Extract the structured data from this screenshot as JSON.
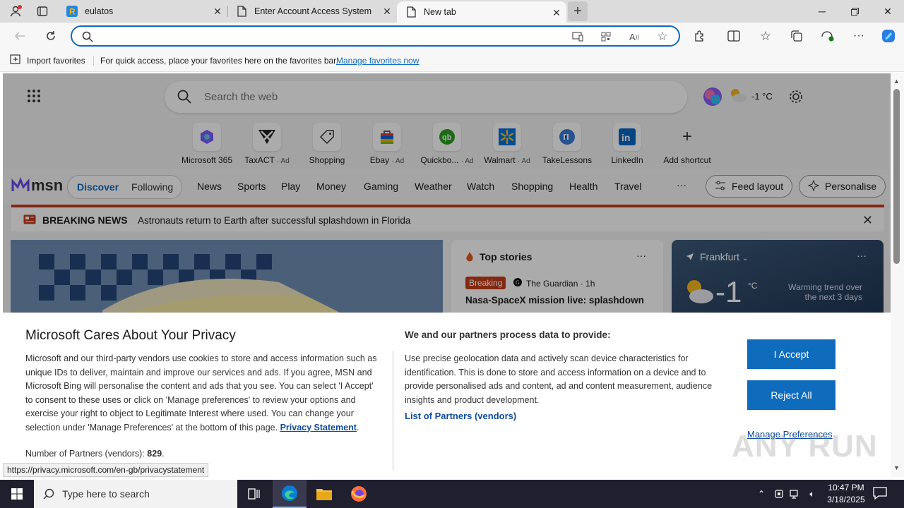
{
  "tabs": [
    {
      "title": "eulatos"
    },
    {
      "title": "Enter Account Access System"
    },
    {
      "title": "New tab"
    }
  ],
  "favorites_bar": {
    "import_label": "Import favorites",
    "hint": "For quick access, place your favorites here on the favorites bar.",
    "manage_link": "Manage favorites now"
  },
  "newtab": {
    "search_placeholder": "Search the web",
    "weather_small": "-1 °C",
    "shortcuts": [
      {
        "label": "Microsoft 365",
        "ad": ""
      },
      {
        "label": "TaxACT",
        "ad": "· Ad"
      },
      {
        "label": "Shopping",
        "ad": ""
      },
      {
        "label": "Ebay",
        "ad": "· Ad"
      },
      {
        "label": "Quickbo...",
        "ad": "· Ad"
      },
      {
        "label": "Walmart",
        "ad": "· Ad"
      },
      {
        "label": "TakeLessons",
        "ad": ""
      },
      {
        "label": "LinkedIn",
        "ad": ""
      },
      {
        "label": "Add shortcut",
        "ad": ""
      }
    ]
  },
  "msn": {
    "logo": "msn",
    "discover": "Discover",
    "following": "Following",
    "nav": [
      "News",
      "Sports",
      "Play",
      "Money",
      "Gaming",
      "Weather",
      "Watch",
      "Shopping",
      "Health",
      "Travel"
    ],
    "more": "···",
    "feed_layout": "Feed layout",
    "personalise": "Personalise"
  },
  "breaking": {
    "label": "BREAKING NEWS",
    "text": "Astronauts return to Earth after successful splashdown in Florida"
  },
  "top_stories": {
    "title": "Top stories",
    "badge": "Breaking",
    "source": "The Guardian · 1h",
    "headline": "Nasa-SpaceX mission live: splashdown"
  },
  "weather_card": {
    "city": "Frankfurt",
    "temp": "-1",
    "unit": "°C",
    "trend": "Warming trend over the next 3 days"
  },
  "privacy": {
    "title": "Microsoft Cares About Your Privacy",
    "body": "Microsoft and our third-party vendors use cookies to store and access information such as unique IDs to deliver, maintain and improve our services and ads. If you agree, MSN and Microsoft Bing will personalise the content and ads that you see. You can select 'I Accept' to consent to these uses or click on 'Manage preferences' to review your options and exercise your right to object to Legitimate Interest where used.  You can change your selection under 'Manage Preferences' at the bottom of this page.",
    "statement_link": "Privacy Statement",
    "partners_label": "Number of Partners (vendors):",
    "partners_count": "829",
    "heading2": "We and our partners process data to provide:",
    "body2": "Use precise geolocation data and actively scan device characteristics for identification. This is done to store and access information on a device and to provide personalised ads and content, ad and content measurement, audience insights and product development.",
    "vendors_link": "List of Partners (vendors)",
    "accept": "I Accept",
    "reject": "Reject All",
    "manage": "Manage Preferences"
  },
  "status_url": "https://privacy.microsoft.com/en-gb/privacystatement",
  "watermark": "ANY RUN",
  "taskbar": {
    "search_placeholder": "Type here to search",
    "time": "10:47 PM",
    "date": "3/18/2025"
  },
  "colors": {
    "accent": "#0f6cbd",
    "breaking_red": "#c43c1c"
  }
}
